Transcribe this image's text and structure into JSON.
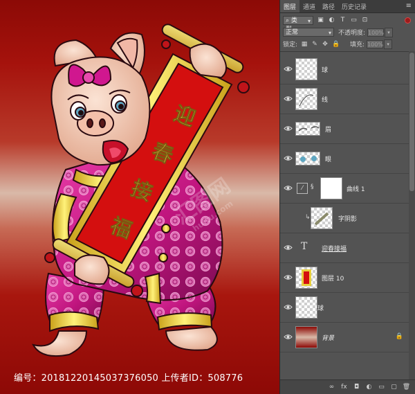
{
  "watermark": {
    "text": "编号：20181220145037376050 上传者ID：508776",
    "site_logo": "汇图网"
  },
  "couplet": {
    "chars": [
      "迎",
      "春",
      "接",
      "福"
    ]
  },
  "panel": {
    "tabs": [
      "图层",
      "通道",
      "路径",
      "历史记录"
    ],
    "menu_icon": "panel-menu-icon",
    "filter_kind": "类型",
    "blend_mode": "正常",
    "opacity_label": "不透明度:",
    "opacity_value": "100%",
    "lock_label": "锁定:",
    "fill_label": "填充:",
    "fill_value": "100%",
    "layers": [
      {
        "name": "球",
        "type": "pixel"
      },
      {
        "name": "线",
        "type": "pixel"
      },
      {
        "name": "眉",
        "type": "pixel"
      },
      {
        "name": "眼",
        "type": "pixel"
      },
      {
        "name": "曲线 1",
        "type": "adjustment"
      },
      {
        "name": "字阴影",
        "type": "clipped"
      },
      {
        "name": "迎春接福",
        "type": "text",
        "thumb_glyph": "T"
      },
      {
        "name": "图层 10",
        "type": "pixel"
      },
      {
        "name": "球",
        "type": "pixel"
      },
      {
        "name": "背景",
        "type": "background",
        "locked": true
      }
    ],
    "bottom_icons": [
      "link-icon",
      "fx-icon",
      "mask-icon",
      "adjustment-icon",
      "group-icon",
      "new-layer-icon",
      "trash-icon"
    ],
    "bottom_glyphs": [
      "∞",
      "fx",
      "◘",
      "◐",
      "▭",
      "▢",
      "🗑"
    ]
  },
  "colors": {
    "canvas_dark": "#8c0a06",
    "canvas_light": "#d9b9a8",
    "panel_bg": "#535353",
    "couplet_red": "#d40f0f",
    "gold": "#e8cf3c"
  }
}
